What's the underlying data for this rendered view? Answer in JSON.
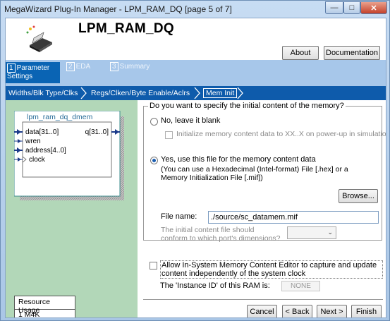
{
  "window": {
    "title": "MegaWizard Plug-In Manager - LPM_RAM_DQ [page 5 of 7]",
    "header_title": "LPM_RAM_DQ",
    "about_label": "About",
    "documentation_label": "Documentation"
  },
  "steps": [
    {
      "num": "1",
      "label": "Parameter Settings"
    },
    {
      "num": "2",
      "label": "EDA"
    },
    {
      "num": "3",
      "label": "Summary"
    }
  ],
  "breadcrumbs": [
    "Widths/Blk Type/Clks",
    "Regs/Clken/Byte Enable/Aclrs",
    "Mem Init"
  ],
  "symbol": {
    "name": "lpm_ram_dq_dmem",
    "ports_in": [
      "data[31..0]",
      "wren",
      "address[4..0]",
      "clock"
    ],
    "port_out": "q[31..0]"
  },
  "resource": {
    "title": "Resource Usage",
    "value": "1 M4K"
  },
  "init": {
    "question": "Do you want to specify the initial content of the memory?",
    "no_label": "No, leave it blank",
    "init_xx_label": "Initialize memory content data to XX..X on power-up in simulation",
    "yes_label": "Yes, use this file for the memory content data",
    "yes_desc": "(You can use a Hexadecimal (Intel-format) File [.hex] or a Memory Initialization File [.mif])",
    "browse_label": "Browse...",
    "file_label": "File name:",
    "file_value": "./source/sc_datamem.mif",
    "conform_text": "The initial content file should conform to which port's dimensions?"
  },
  "editor": {
    "label": "Allow In-System Memory Content Editor to capture and update content independently of the system clock",
    "instance_label": "The 'Instance ID' of this RAM is:",
    "instance_value": "NONE"
  },
  "nav": {
    "cancel": "Cancel",
    "back": "< Back",
    "next": "Next >",
    "finish": "Finish"
  }
}
